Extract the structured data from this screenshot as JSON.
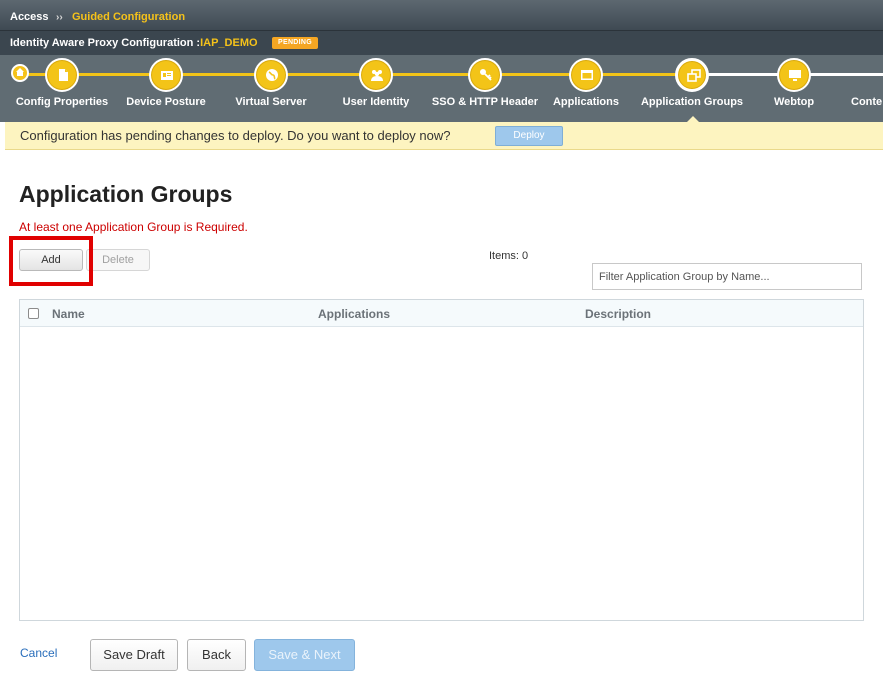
{
  "breadcrumb": {
    "root": "Access",
    "separator": "››",
    "current": "Guided Configuration"
  },
  "config_header": {
    "title_prefix": "Identity Aware Proxy Configuration :",
    "config_name": "IAP_DEMO",
    "status_badge": "PENDING"
  },
  "wizard": {
    "home_icon": "home-icon",
    "steps": [
      {
        "label": "Config Properties",
        "icon": "document-icon"
      },
      {
        "label": "Device Posture",
        "icon": "id-card-icon"
      },
      {
        "label": "Virtual Server",
        "icon": "globe-icon"
      },
      {
        "label": "User Identity",
        "icon": "users-icon"
      },
      {
        "label": "SSO & HTTP Header",
        "icon": "key-icon"
      },
      {
        "label": "Applications",
        "icon": "window-icon"
      },
      {
        "label": "Application Groups",
        "icon": "windows-stack-icon"
      },
      {
        "label": "Webtop",
        "icon": "monitor-icon"
      },
      {
        "label": "Conte",
        "icon": "circle-icon"
      }
    ],
    "active_step": "Application Groups"
  },
  "banner": {
    "message": "Configuration has pending changes to deploy. Do you want to deploy now?",
    "deploy_label": "Deploy"
  },
  "main": {
    "title": "Application Groups",
    "error": "At least one Application Group is Required.",
    "add_label": "Add",
    "delete_label": "Delete",
    "items_count": "Items: 0",
    "filter_placeholder": "Filter Application Group by Name...",
    "columns": [
      "Name",
      "Applications",
      "Description"
    ]
  },
  "footer": {
    "cancel_label": "Cancel",
    "save_draft_label": "Save Draft",
    "back_label": "Back",
    "save_next_label": "Save & Next"
  },
  "colors": {
    "accent_yellow": "#f3c418",
    "error_red": "#cc0000",
    "highlight_red": "#e00000",
    "disabled_blue": "#9ec8ec",
    "link_blue": "#2a6ebb"
  }
}
